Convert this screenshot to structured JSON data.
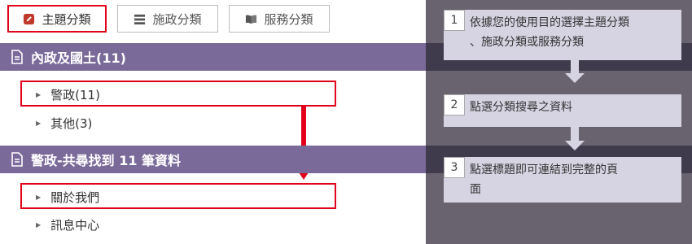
{
  "tabs": [
    {
      "label": "主題分類",
      "icon": "pencil-note-icon",
      "active": true
    },
    {
      "label": "施政分類",
      "icon": "list-icon",
      "active": false
    },
    {
      "label": "服務分類",
      "icon": "book-icon",
      "active": false
    }
  ],
  "category_section": {
    "heading": "內政及國土(11)",
    "items": [
      "警政(11)",
      "其他(3)"
    ]
  },
  "results_section": {
    "heading": "警政-共尋找到 11 筆資料",
    "items": [
      "關於我們",
      "訊息中心"
    ]
  },
  "guide": {
    "steps": [
      {
        "number": "1",
        "line1": "依據您的使用目的選擇主題分類",
        "line2": "、施政分類或服務分類"
      },
      {
        "number": "2",
        "line1": "點選分類搜尋之資料"
      },
      {
        "number": "3",
        "line1": "點選標題即可連結到完整的頁",
        "line2": "面"
      }
    ]
  },
  "colors": {
    "accent_red": "#e2001a",
    "section_bar": "#7a6a9a",
    "guide_panel": "#68636e",
    "guide_card": "#d6d4e2"
  }
}
